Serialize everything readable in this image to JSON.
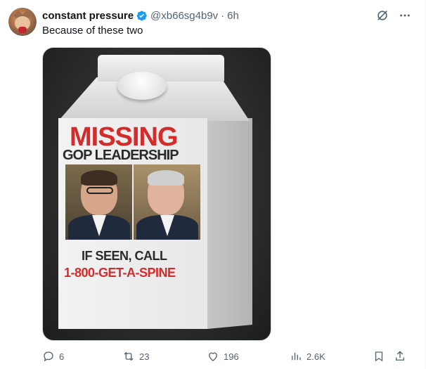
{
  "tweet": {
    "display_name": "constant pressure",
    "handle": "@xb66sg4b9v",
    "separator": "·",
    "time": "6h",
    "text": "Because of these two"
  },
  "image": {
    "headline": "MISSING",
    "subheadline": "GOP LEADERSHIP",
    "call_line": "IF SEEN, CALL",
    "phone": "1-800-GET-A-SPINE"
  },
  "actions": {
    "replies": "6",
    "reposts": "23",
    "likes": "196",
    "views": "2.6K"
  },
  "colors": {
    "verified": "#1d9bf0",
    "icon_gray": "#536471",
    "accent_red": "#d42b2b"
  },
  "icons": [
    "verified-badge-icon",
    "grok-icon",
    "more-icon",
    "reply-icon",
    "repost-icon",
    "like-icon",
    "views-icon",
    "bookmark-icon",
    "share-icon"
  ]
}
